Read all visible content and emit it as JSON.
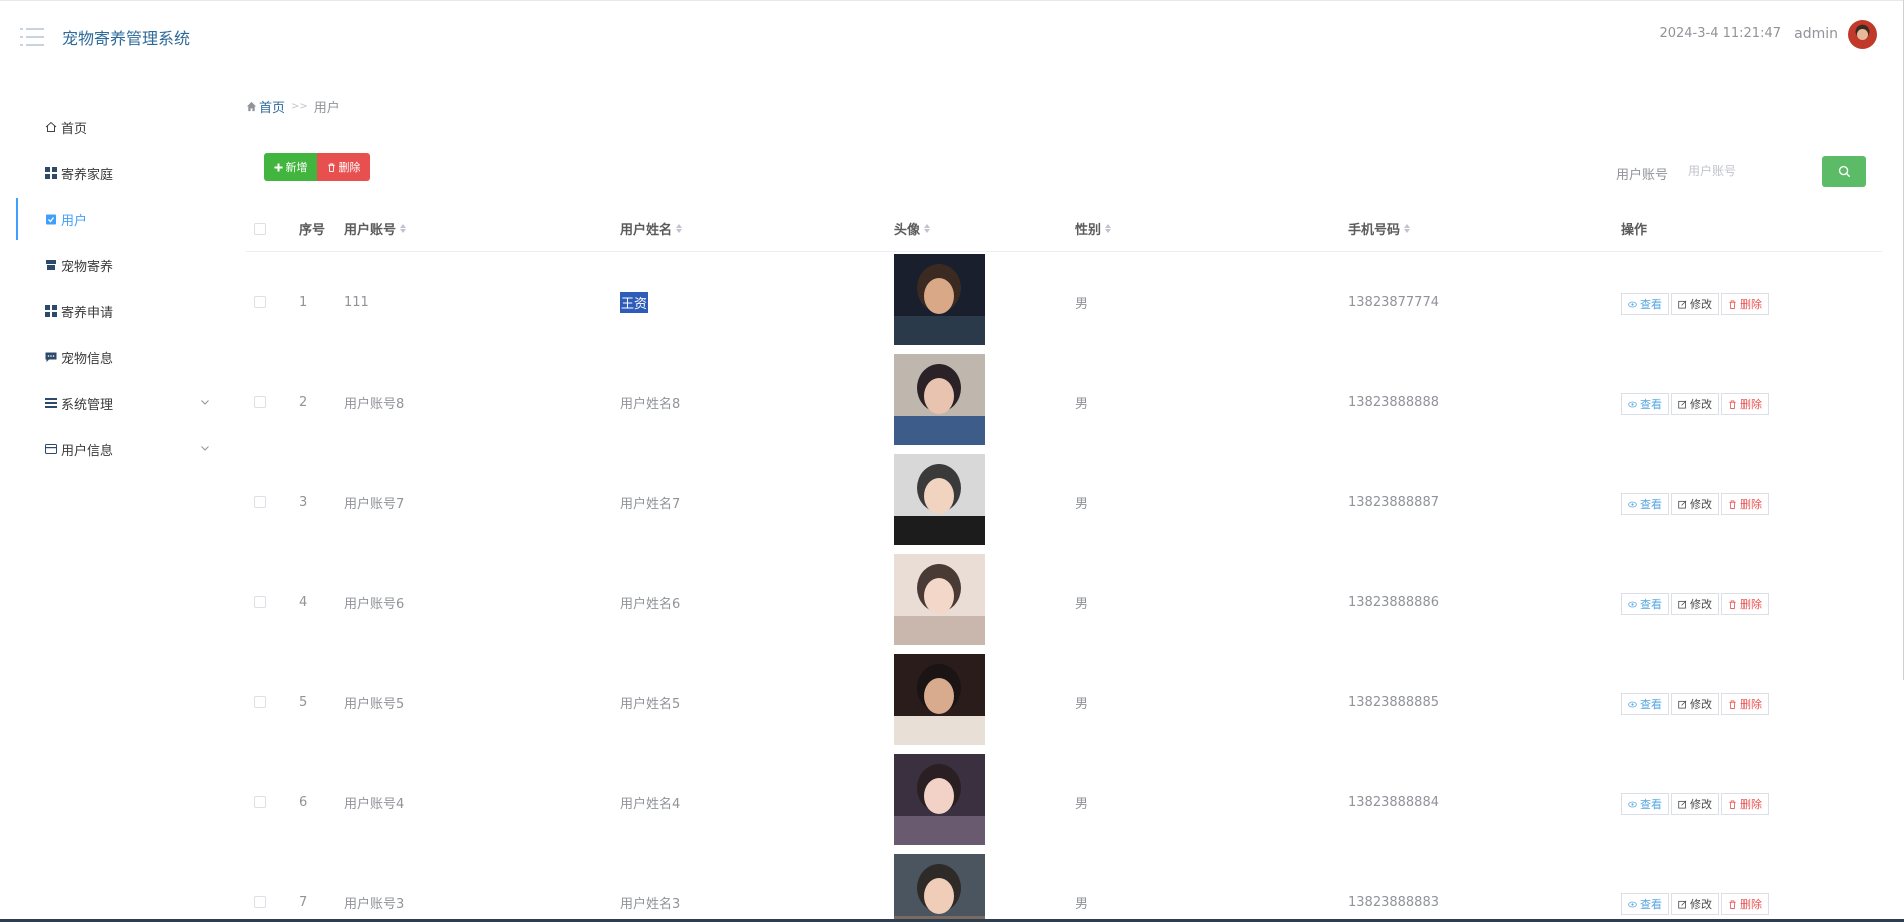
{
  "header": {
    "title": "宠物寄养管理系统",
    "time": "2024-3-4 11:21:47",
    "user": "admin"
  },
  "sidebar": {
    "items": [
      {
        "label": "首页",
        "icon": "home-icon"
      },
      {
        "label": "寄养家庭",
        "icon": "grid-icon"
      },
      {
        "label": "用户",
        "icon": "clipboard-icon",
        "active": true
      },
      {
        "label": "宠物寄养",
        "icon": "store-icon"
      },
      {
        "label": "寄养申请",
        "icon": "grid-icon"
      },
      {
        "label": "宠物信息",
        "icon": "message-icon"
      },
      {
        "label": "系统管理",
        "icon": "list-icon",
        "expandable": true
      },
      {
        "label": "用户信息",
        "icon": "card-icon",
        "expandable": true
      }
    ]
  },
  "breadcrumb": {
    "home": "首页",
    "separator": ">>",
    "current": "用户"
  },
  "toolbar": {
    "add_label": "新增",
    "delete_label": "删除"
  },
  "search": {
    "label": "用户账号",
    "placeholder": "用户账号"
  },
  "table": {
    "columns": [
      "序号",
      "用户账号",
      "用户姓名",
      "头像",
      "性别",
      "手机号码",
      "操作"
    ],
    "actions": {
      "view": "查看",
      "edit": "修改",
      "delete": "删除"
    },
    "rows": [
      {
        "index": "1",
        "account": "111",
        "name": "王资",
        "gender": "男",
        "phone": "13823877774",
        "name_selected": true
      },
      {
        "index": "2",
        "account": "用户账号8",
        "name": "用户姓名8",
        "gender": "男",
        "phone": "13823888888"
      },
      {
        "index": "3",
        "account": "用户账号7",
        "name": "用户姓名7",
        "gender": "男",
        "phone": "13823888887"
      },
      {
        "index": "4",
        "account": "用户账号6",
        "name": "用户姓名6",
        "gender": "男",
        "phone": "13823888886"
      },
      {
        "index": "5",
        "account": "用户账号5",
        "name": "用户姓名5",
        "gender": "男",
        "phone": "13823888885"
      },
      {
        "index": "6",
        "account": "用户账号4",
        "name": "用户姓名4",
        "gender": "男",
        "phone": "13823888884"
      },
      {
        "index": "7",
        "account": "用户账号3",
        "name": "用户姓名3",
        "gender": "男",
        "phone": "13823888883"
      }
    ]
  },
  "colors": {
    "brand": "#2d6a9a",
    "active": "#409eff",
    "add": "#42b53f",
    "delete": "#e85050",
    "search": "#5cbb67"
  }
}
